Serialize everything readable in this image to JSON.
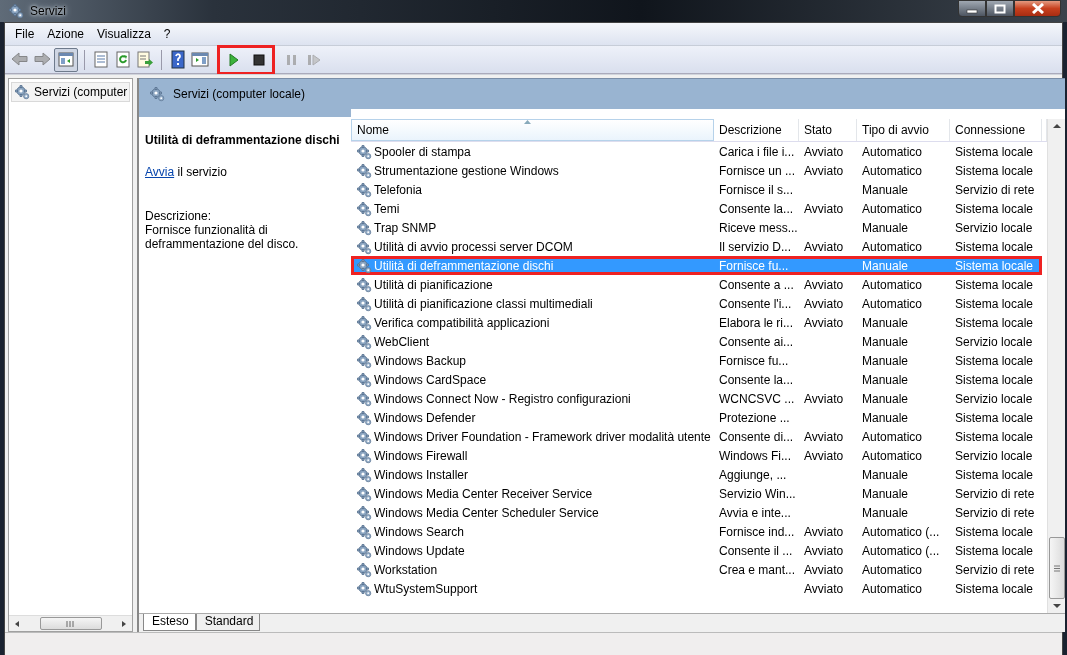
{
  "window": {
    "title": "Servizi"
  },
  "menu": [
    "File",
    "Azione",
    "Visualizza",
    "?"
  ],
  "toolbar": [
    {
      "kind": "back",
      "disabled": true,
      "highlighted": false
    },
    {
      "kind": "forward",
      "disabled": true,
      "highlighted": false
    },
    {
      "kind": "tree",
      "disabled": false,
      "highlighted": false,
      "pressed": true
    },
    {
      "kind": "sep"
    },
    {
      "kind": "properties",
      "disabled": false,
      "highlighted": false
    },
    {
      "kind": "refresh",
      "disabled": false,
      "highlighted": false
    },
    {
      "kind": "export",
      "disabled": false,
      "highlighted": false
    },
    {
      "kind": "sep"
    },
    {
      "kind": "help",
      "disabled": false,
      "highlighted": false
    },
    {
      "kind": "pane",
      "disabled": false,
      "highlighted": false
    },
    {
      "kind": "play",
      "disabled": false,
      "highlighted": true
    },
    {
      "kind": "stop",
      "disabled": false,
      "highlighted": true
    },
    {
      "kind": "pause",
      "disabled": true,
      "highlighted": false
    },
    {
      "kind": "resume",
      "disabled": true,
      "highlighted": false
    }
  ],
  "tree": {
    "items": [
      {
        "label": "Servizi (computer",
        "selected": false
      }
    ]
  },
  "header": {
    "title": "Servizi (computer locale)"
  },
  "details": {
    "title": "Utilità di deframmentazione dischi",
    "action_link": "Avvia",
    "action_text": " il servizio",
    "description_label": "Descrizione:",
    "description": "Fornisce funzionalità di deframmentazione del disco."
  },
  "table": {
    "columns": [
      "Nome",
      "Descrizione",
      "Stato",
      "Tipo di avvio",
      "Connessione"
    ],
    "rows": [
      {
        "name": "Spooler di stampa",
        "description": "Carica i file i...",
        "status": "Avviato",
        "startup": "Automatico",
        "logon": "Sistema locale",
        "selected": false,
        "highlighted": false
      },
      {
        "name": "Strumentazione gestione Windows",
        "description": "Fornisce un ...",
        "status": "Avviato",
        "startup": "Automatico",
        "logon": "Sistema locale",
        "selected": false,
        "highlighted": false
      },
      {
        "name": "Telefonia",
        "description": "Fornisce il s...",
        "startup": "Manuale",
        "logon": "Servizio di rete",
        "selected": false,
        "highlighted": false
      },
      {
        "name": "Temi",
        "description": "Consente la...",
        "status": "Avviato",
        "startup": "Automatico",
        "logon": "Sistema locale",
        "selected": false,
        "highlighted": false
      },
      {
        "name": "Trap SNMP",
        "description": "Riceve mess...",
        "startup": "Manuale",
        "logon": "Servizio locale",
        "selected": false,
        "highlighted": false
      },
      {
        "name": "Utilità di avvio processi server DCOM",
        "description": "Il servizio D...",
        "status": "Avviato",
        "startup": "Automatico",
        "logon": "Sistema locale",
        "selected": false,
        "highlighted": false
      },
      {
        "name": "Utilità di deframmentazione dischi",
        "description": "Fornisce fu...",
        "startup": "Manuale",
        "logon": "Sistema locale",
        "selected": true,
        "highlighted": true
      },
      {
        "name": "Utilità di pianificazione",
        "description": "Consente a ...",
        "status": "Avviato",
        "startup": "Automatico",
        "logon": "Sistema locale",
        "selected": false,
        "highlighted": false
      },
      {
        "name": "Utilità di pianificazione classi multimediali",
        "description": "Consente l'i...",
        "status": "Avviato",
        "startup": "Automatico",
        "logon": "Sistema locale",
        "selected": false,
        "highlighted": false
      },
      {
        "name": "Verifica compatibilità applicazioni",
        "description": "Elabora le ri...",
        "status": "Avviato",
        "startup": "Manuale",
        "logon": "Sistema locale",
        "selected": false,
        "highlighted": false
      },
      {
        "name": "WebClient",
        "description": "Consente ai...",
        "startup": "Manuale",
        "logon": "Servizio locale",
        "selected": false,
        "highlighted": false
      },
      {
        "name": "Windows Backup",
        "description": "Fornisce fu...",
        "startup": "Manuale",
        "logon": "Sistema locale",
        "selected": false,
        "highlighted": false
      },
      {
        "name": "Windows CardSpace",
        "description": "Consente la...",
        "startup": "Manuale",
        "logon": "Sistema locale",
        "selected": false,
        "highlighted": false
      },
      {
        "name": "Windows Connect Now - Registro configurazioni",
        "description": "WCNCSVC ...",
        "status": "Avviato",
        "startup": "Manuale",
        "logon": "Servizio locale",
        "selected": false,
        "highlighted": false
      },
      {
        "name": "Windows Defender",
        "description": "Protezione ...",
        "startup": "Manuale",
        "logon": "Sistema locale",
        "selected": false,
        "highlighted": false
      },
      {
        "name": "Windows Driver Foundation - Framework driver modalità utente",
        "description": "Consente di...",
        "status": "Avviato",
        "startup": "Automatico",
        "logon": "Sistema locale",
        "selected": false,
        "highlighted": false
      },
      {
        "name": "Windows Firewall",
        "description": "Windows Fi...",
        "status": "Avviato",
        "startup": "Automatico",
        "logon": "Servizio locale",
        "selected": false,
        "highlighted": false
      },
      {
        "name": "Windows Installer",
        "description": "Aggiunge, ...",
        "startup": "Manuale",
        "logon": "Sistema locale",
        "selected": false,
        "highlighted": false
      },
      {
        "name": "Windows Media Center Receiver Service",
        "description": "Servizio Win...",
        "startup": "Manuale",
        "logon": "Servizio di rete",
        "selected": false,
        "highlighted": false
      },
      {
        "name": "Windows Media Center Scheduler Service",
        "description": "Avvia e inte...",
        "startup": "Manuale",
        "logon": "Servizio di rete",
        "selected": false,
        "highlighted": false
      },
      {
        "name": "Windows Search",
        "description": "Fornisce ind...",
        "status": "Avviato",
        "startup": "Automatico (...",
        "logon": "Sistema locale",
        "selected": false,
        "highlighted": false
      },
      {
        "name": "Windows Update",
        "description": "Consente il ...",
        "status": "Avviato",
        "startup": "Automatico (...",
        "logon": "Sistema locale",
        "selected": false,
        "highlighted": false
      },
      {
        "name": "Workstation",
        "description": "Crea e mant...",
        "status": "Avviato",
        "startup": "Automatico",
        "logon": "Servizio di rete",
        "selected": false,
        "highlighted": false
      },
      {
        "name": "WtuSystemSupport",
        "status": "Avviato",
        "startup": "Automatico",
        "logon": "Sistema locale",
        "selected": false,
        "highlighted": false
      }
    ]
  },
  "tabs": [
    {
      "label": "Esteso",
      "selected": true
    },
    {
      "label": "Standard",
      "selected": false
    }
  ]
}
